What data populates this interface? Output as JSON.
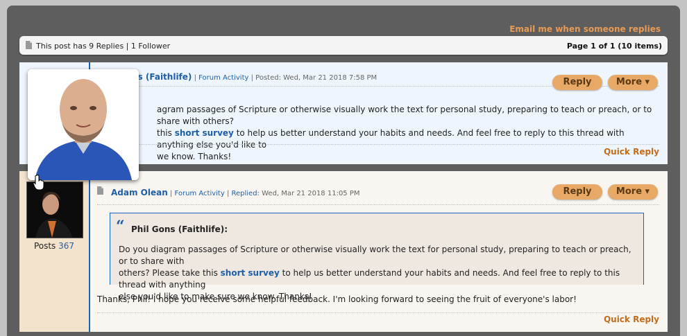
{
  "header": {
    "email_link": "Email me when someone replies"
  },
  "infobar": {
    "count_text": "This post has 9 Replies | 1 Follower",
    "page_text": "Page 1 of 1 (10 items)"
  },
  "post1": {
    "author": "ns (Faithlife)",
    "sep1": " | ",
    "forum_activity": "Forum Activity",
    "posted": " | Posted: Wed, Mar 21 2018 7:58 PM",
    "reply_label": "Reply",
    "more_label": "More ▾",
    "body_line1": "agram passages of Scripture or otherwise visually work the text for personal study, preparing to teach or preach, or to share with others?",
    "body_line2_pre": "this ",
    "survey_link": "short survey",
    "body_line2_post": " to help us better understand your habits and needs. And feel free to reply to this thread with anything else you'd like to",
    "body_line3": "we know. Thanks!",
    "quick_reply": "Quick Reply"
  },
  "post2": {
    "author": "Adam Olean",
    "sep1": " | ",
    "forum_activity": "Forum Activity",
    "sep2": " | ",
    "replied_label": "Replied:",
    "replied_date": " Wed, Mar 21 2018 11:05 PM",
    "posts_label": "Posts",
    "posts_count": "367",
    "reply_label": "Reply",
    "more_label": "More ▾",
    "quote_mark": "“",
    "quote_author": "Phil Gons (Faithlife):",
    "quote_line1": "Do you diagram passages of Scripture or otherwise visually work the text for personal study, preparing to teach or preach, or to share with",
    "quote_line2_pre": "others? Please take this ",
    "quote_link": "short survey",
    "quote_line2_post": " to help us better understand your habits and needs. And feel free to reply to this thread with anything",
    "quote_line3": "else you'd like to make sure we know. Thanks!",
    "body": "Thanks, Phil! I hope you receive some helpful feedback. I'm looking forward to seeing the fruit of everyone's labor!",
    "quick_reply": "Quick Reply"
  },
  "icons": [
    "document-icon",
    "pointer-hand-icon",
    "quote-icon",
    "avatar-photo"
  ],
  "colors": {
    "accent_orange": "#e8a966",
    "link_blue": "#1f5fa8",
    "quick_reply": "#c46c1a",
    "email_link": "#e89a55"
  }
}
